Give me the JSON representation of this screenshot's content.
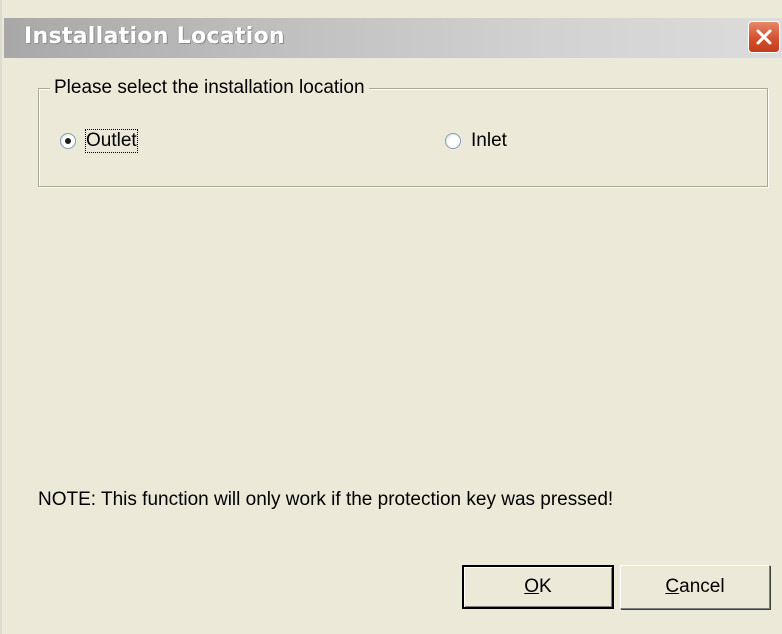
{
  "window": {
    "title": "Installation Location",
    "close_icon": "close-x-icon"
  },
  "group": {
    "legend": "Please select the installation location",
    "options": [
      {
        "label": "Outlet",
        "selected": true
      },
      {
        "label": "Inlet",
        "selected": false
      }
    ]
  },
  "note": "NOTE: This function will only work if the protection key was pressed!",
  "buttons": {
    "ok": {
      "mnemonic": "O",
      "rest": "K"
    },
    "cancel": {
      "mnemonic": "C",
      "rest": "ancel"
    }
  },
  "colors": {
    "close_button": "#d4502e",
    "window_background": "#ece9d8"
  }
}
